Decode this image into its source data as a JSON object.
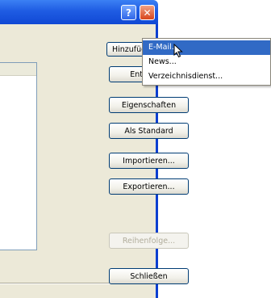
{
  "titlebar": {
    "help_glyph": "?",
    "close_glyph": "✕"
  },
  "buttons": {
    "add": "Hinzufügen",
    "add_arrow": "▶",
    "remove": "Entfernen",
    "properties": "Eigenschaften",
    "default": "Als Standard",
    "import": "Importieren...",
    "export": "Exportieren...",
    "order": "Reihenfolge...",
    "close": "Schließen"
  },
  "menu": {
    "items": [
      "E-Mail...",
      "News...",
      "Verzeichnisdienst..."
    ],
    "highlighted_index": 0
  },
  "icons": {
    "help": "help-icon",
    "close": "close-icon",
    "cursor": "mouse-pointer-icon",
    "submenu": "submenu-arrow-icon"
  },
  "colors": {
    "titlebar": "#1f5ce3",
    "dialog_bg": "#ece9d8",
    "menu_highlight": "#316ac5",
    "close_button": "#d8461c"
  }
}
